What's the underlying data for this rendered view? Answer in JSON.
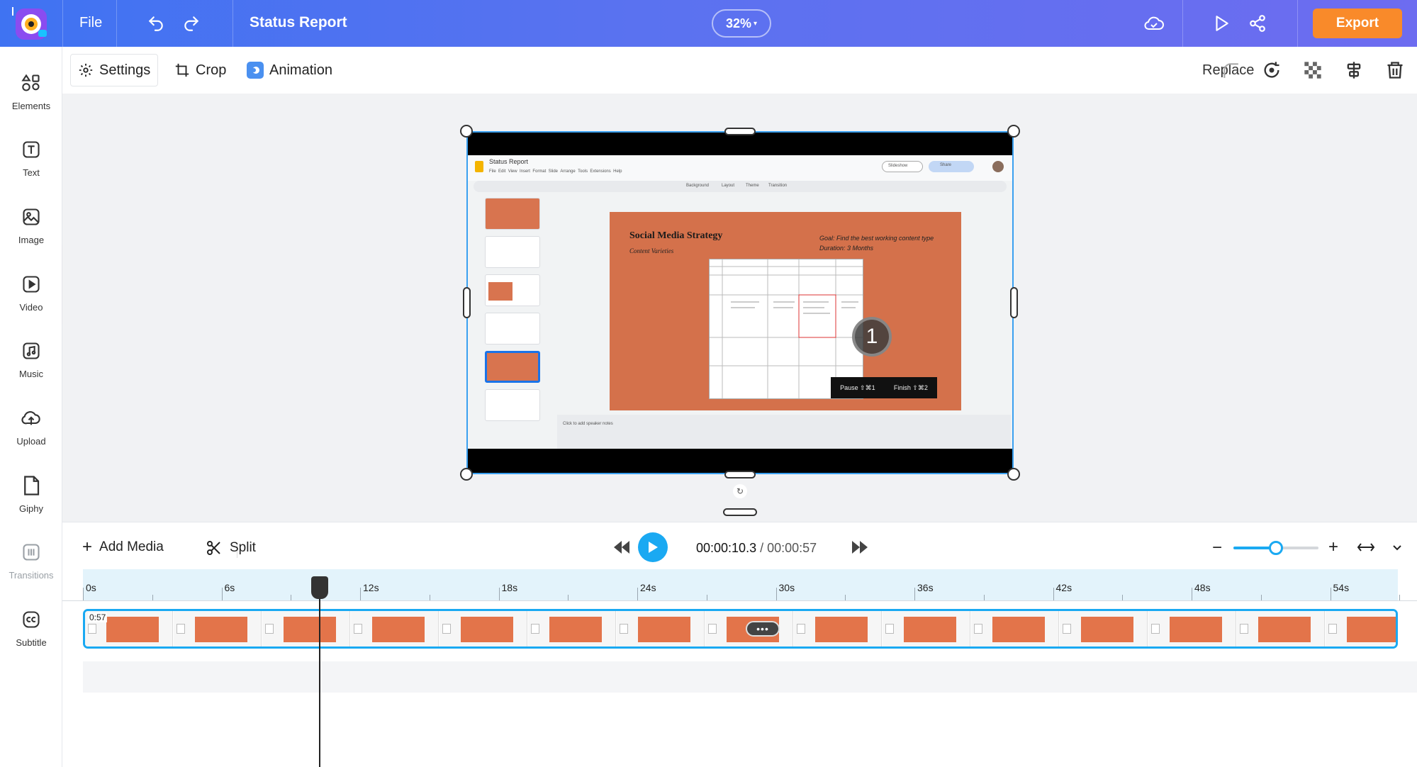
{
  "app": {
    "file_label": "File",
    "project_title": "Status Report",
    "zoom_label": "32%",
    "export_label": "Export"
  },
  "sidebar": {
    "items": [
      {
        "label": "Elements",
        "icon": "elements-icon"
      },
      {
        "label": "Text",
        "icon": "text-icon"
      },
      {
        "label": "Image",
        "icon": "image-icon"
      },
      {
        "label": "Video",
        "icon": "video-icon"
      },
      {
        "label": "Music",
        "icon": "music-icon"
      },
      {
        "label": "Upload",
        "icon": "upload-icon"
      },
      {
        "label": "Giphy",
        "icon": "giphy-icon"
      },
      {
        "label": "Transitions",
        "icon": "transitions-icon"
      },
      {
        "label": "Subtitle",
        "icon": "subtitle-icon"
      }
    ]
  },
  "toolbar": {
    "settings_label": "Settings",
    "crop_label": "Crop",
    "animation_label": "Animation",
    "replace_label": "Replace"
  },
  "slides_app": {
    "doc_title": "Status Report",
    "menu": [
      "File",
      "Edit",
      "View",
      "Insert",
      "Format",
      "Slide",
      "Arrange",
      "Tools",
      "Extensions",
      "Help"
    ],
    "slideshow_label": "Slideshow",
    "share_label": "Share",
    "toolbar_items": [
      "Background",
      "Layout",
      "Theme",
      "Transition"
    ],
    "slide_title": "Social Media Strategy",
    "slide_subtitle": "Content Varieties",
    "slide_goal_line1": "Goal: Find the best working content type",
    "slide_goal_line2": "Duration: 3 Months",
    "recording_number": "1",
    "pause_label": "Pause ⇧⌘1",
    "finish_label": "Finish ⇧⌘2",
    "speaker_notes": "Click to add speaker notes"
  },
  "timeline": {
    "add_media_label": "Add Media",
    "split_label": "Split",
    "current_time": "00:00:10.3",
    "separator": "/",
    "total_time": "00:00:57",
    "clip_duration": "0:57",
    "zoom_level": 0.5,
    "ruler_labels": [
      "0s",
      "6s",
      "12s",
      "18s",
      "24s",
      "30s",
      "36s",
      "42s",
      "48s",
      "54s"
    ]
  },
  "colors": {
    "topbar_start": "#3f73f2",
    "topbar_end": "#6d6cf0",
    "export": "#f98a2a",
    "accent": "#1aa9f2",
    "slide_orange": "#d4714b"
  }
}
